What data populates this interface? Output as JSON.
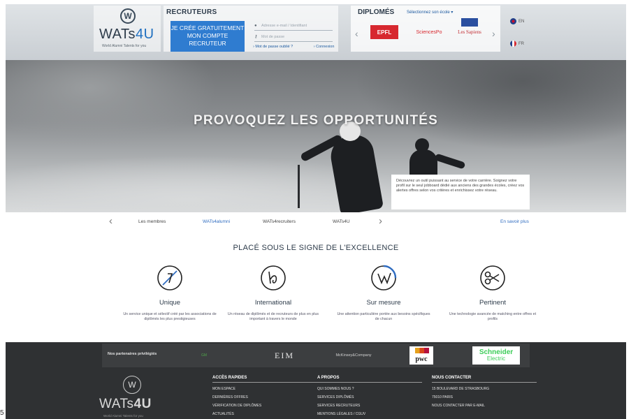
{
  "header": {
    "logo": {
      "text": "WATs4U",
      "tagline": "World Alumni Talents for you"
    },
    "recruiters": {
      "title": "RECRUTEURS",
      "create_button": "JE CRÉE GRATUITEMENT MON COMPTE RECRUTEUR",
      "email_placeholder": "Adresse e-mail / Identifiant",
      "password_placeholder": "Mot de passe",
      "forgot_link": "Mot de passe oublié ?",
      "login_link": "Connexion"
    },
    "graduates": {
      "title": "DIPLOMÉS",
      "school_select": "Sélectionnez son école",
      "schools": [
        "EPFL",
        "SciencesPo",
        "Les Sapiens"
      ]
    },
    "languages": [
      "EN",
      "FR"
    ]
  },
  "hero": {
    "title": "PROVOQUEZ LES OPPORTUNITÉS",
    "card_text": "Découvrez un outil puissant au service de votre carrière. Soignez votre profil sur le seul jobboard dédié aux anciens des grandes écoles, créez vos alertes offres selon vos critères et enrichissez votre réseau."
  },
  "subnav": {
    "items": [
      "Les membres",
      "WATs4alumni",
      "WATs4recruiters",
      "WATs4U"
    ],
    "active_index": 1,
    "more_link": "En savoir plus"
  },
  "excellence": {
    "title": "PLACÉ SOUS LE SIGNE DE L'EXCELLENCE",
    "features": [
      {
        "title": "Unique",
        "desc": "Un service unique et sélectif créé par les associations de diplômés les plus prestigieuses"
      },
      {
        "title": "International",
        "desc": "Un réseau de diplômés et de recruteurs de plus en plus important à travers le monde"
      },
      {
        "title": "Sur mesure",
        "desc": "Une attention particulière portée aux besoins spécifiques de chacun"
      },
      {
        "title": "Pertinent",
        "desc": "Une technologie avancée de matching entre offres et profils"
      }
    ]
  },
  "footer": {
    "partners_label": "Nos partenaires privilégiés",
    "partners": [
      "GM",
      "EIM",
      "McKinsey&Company",
      "pwc",
      "Schneider",
      "Electric"
    ],
    "logo_text": "WATs4U",
    "logo_tagline": "World Alumni Talents for you",
    "quick_access": {
      "title": "ACCÈS RAPIDES",
      "links": [
        "MON ESPACE",
        "DERNIÈRES OFFRES",
        "VÉRIFICATION DE DIPLÔMES",
        "ACTUALITÉS"
      ]
    },
    "about": {
      "title": "A PROPOS",
      "links": [
        "QUI SOMMES NOUS ?",
        "SERVICES DIPLÔMÉS",
        "SERVICES RECRUTEURS",
        "MENTIONS LÉGALES / CGUV"
      ]
    },
    "contact": {
      "title": "NOUS CONTACTER",
      "lines": [
        "15 BOULEVARD DE STRASBOURG",
        "75010 PARIS",
        "NOUS CONTACTER PAR E-MAIL"
      ]
    }
  },
  "corner_digit": "5"
}
